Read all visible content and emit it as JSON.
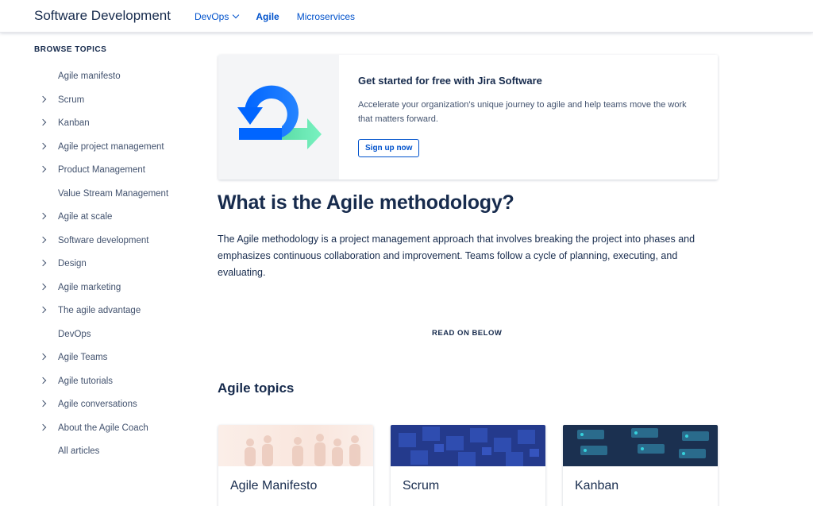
{
  "header": {
    "brand": "Software Development",
    "nav": [
      {
        "label": "DevOps"
      },
      {
        "label": "Agile"
      },
      {
        "label": "Microservices"
      }
    ]
  },
  "sidebar": {
    "title": "BROWSE TOPICS",
    "items": [
      {
        "label": "Agile manifesto",
        "expandable": false
      },
      {
        "label": "Scrum",
        "expandable": true
      },
      {
        "label": "Kanban",
        "expandable": true
      },
      {
        "label": "Agile project management",
        "expandable": true
      },
      {
        "label": "Product Management",
        "expandable": true
      },
      {
        "label": "Value Stream Management",
        "expandable": false
      },
      {
        "label": "Agile at scale",
        "expandable": true
      },
      {
        "label": "Software development",
        "expandable": true
      },
      {
        "label": "Design",
        "expandable": true
      },
      {
        "label": "Agile marketing",
        "expandable": true
      },
      {
        "label": "The agile advantage",
        "expandable": true
      },
      {
        "label": "DevOps",
        "expandable": false
      },
      {
        "label": "Agile Teams",
        "expandable": true
      },
      {
        "label": "Agile tutorials",
        "expandable": true
      },
      {
        "label": "Agile conversations",
        "expandable": true
      },
      {
        "label": "About the Agile Coach",
        "expandable": true
      },
      {
        "label": "All articles",
        "expandable": false
      }
    ]
  },
  "promo": {
    "title": "Get started for free with Jira Software",
    "body": "Accelerate your organization's unique journey to agile and help teams move the work that matters forward.",
    "button": "Sign up now"
  },
  "main": {
    "title": "What is the Agile methodology?",
    "body": "The Agile methodology is a project management approach that involves breaking the project into phases and emphasizes continuous collaboration and improvement. Teams follow a cycle of planning, executing, and evaluating.",
    "read_on": "READ ON BELOW",
    "topics_title": "Agile topics"
  },
  "topics": [
    {
      "title": "Agile Manifesto"
    },
    {
      "title": "Scrum"
    },
    {
      "title": "Kanban"
    }
  ],
  "colors": {
    "link": "#0052CC",
    "text": "#172B4D",
    "muted": "#42526E",
    "loop_blue": "#0065FF",
    "arrow_green": "#57D9A3"
  }
}
